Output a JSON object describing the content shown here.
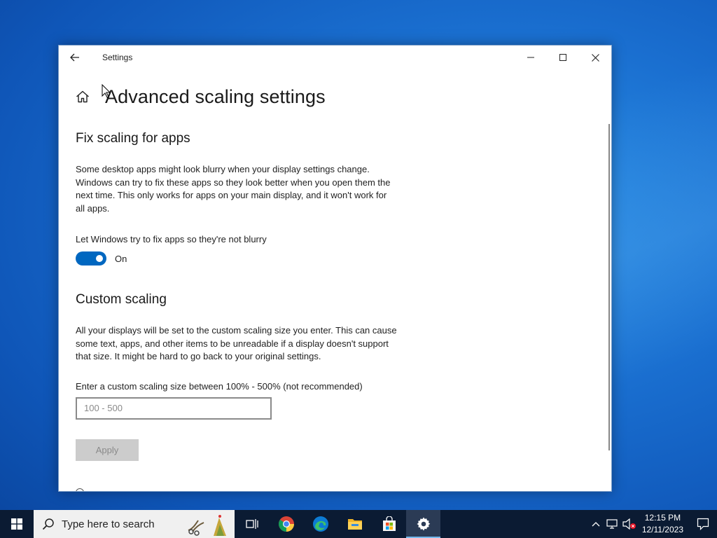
{
  "window": {
    "title": "Settings",
    "page_title": "Advanced scaling settings"
  },
  "fix_scaling": {
    "heading": "Fix scaling for apps",
    "description": "Some desktop apps might look blurry when your display settings change. Windows can try to fix these apps so they look better when you open them the next time. This only works for apps on your main display, and it won't work for all apps.",
    "toggle_label": "Let Windows try to fix apps so they're not blurry",
    "toggle_state": "On",
    "toggle_on": true
  },
  "custom_scaling": {
    "heading": "Custom scaling",
    "description": "All your displays will be set to the custom scaling size you enter. This can cause some text, apps, and other items to be unreadable if a display doesn't support that size. It might be hard to go back to your original settings.",
    "input_label": "Enter a custom scaling size between 100% - 500% (not recommended)",
    "input_placeholder": "100 - 500",
    "input_value": "",
    "apply_label": "Apply"
  },
  "taskbar": {
    "search_placeholder": "Type here to search",
    "pinned": [
      "task-view-icon",
      "chrome-icon",
      "edge-icon",
      "file-explorer-icon",
      "store-icon",
      "settings-gear-icon"
    ],
    "time": "12:15 PM",
    "date": "12/11/2023"
  },
  "colors": {
    "accent": "#0067c0",
    "taskbar": "#0b1b33",
    "desktop": "#1a6fd0"
  }
}
